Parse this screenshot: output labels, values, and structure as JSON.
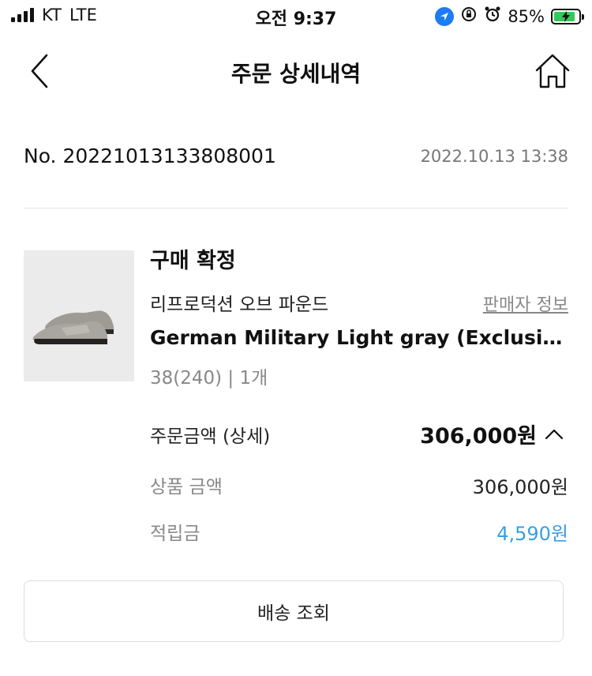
{
  "status_bar": {
    "carrier": "KT",
    "network": "LTE",
    "time": "오전 9:37",
    "battery": "85%",
    "battery_level": 0.85
  },
  "header": {
    "title": "주문 상세내역",
    "back_icon": "chevron-left-icon",
    "home_icon": "home-icon"
  },
  "order": {
    "number": "No. 20221013133808001",
    "datetime": "2022.10.13 13:38"
  },
  "product": {
    "status": "구매 확정",
    "brand": "리프로덕션 오브 파운드",
    "seller_link": "판매자 정보",
    "name": "German Military Light gray (Exclusiv...",
    "option": "38(240)  |  1개",
    "image_icon": "sneaker-image"
  },
  "amount": {
    "total_label": "주문금액 (상세)",
    "total_value": "306,000원",
    "rows": [
      {
        "label": "상품 금액",
        "value": "306,000원"
      },
      {
        "label": "적립금",
        "value": "4,590원"
      }
    ]
  },
  "actions": {
    "track_shipping": "배송 조회"
  },
  "colors": {
    "accent_blue": "#3a9ee4",
    "battery_green": "#34c759",
    "location_blue": "#1e7cf2"
  }
}
